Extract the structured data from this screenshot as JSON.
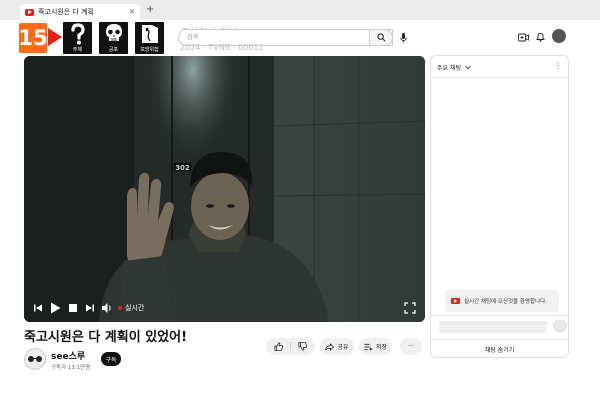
{
  "browser": {
    "tab_title": "죽고시원은 다 계획",
    "tab_close": "✕",
    "new_tab": "+"
  },
  "rating": {
    "age": "15",
    "descriptors": [
      {
        "label": "주제"
      },
      {
        "label": "공포"
      },
      {
        "label": "모방위험"
      }
    ]
  },
  "overlay": {
    "channel_text": "주식회사 티빙",
    "code_text": "2024 - TVNB - 00012"
  },
  "search": {
    "placeholder": "검색"
  },
  "player": {
    "live_label": "실시간",
    "door_number": "302"
  },
  "video": {
    "title": "죽고시원은 다 계획이 있었어!"
  },
  "channel": {
    "name": "see스루",
    "subscribers": "구독자 13.1만명",
    "subscribe_label": "구독"
  },
  "actions": {
    "share_label": "공유",
    "save_label": "저장",
    "more_label": "···"
  },
  "chat": {
    "title": "주요 채팅",
    "welcome": "실시간 채팅에 오신것을 환영합니다.",
    "hide_label": "채팅 숨기기"
  },
  "colors": {
    "rating_orange": "#ff6a13",
    "youtube_red": "#e62117",
    "video_bg": "#1d2320"
  }
}
